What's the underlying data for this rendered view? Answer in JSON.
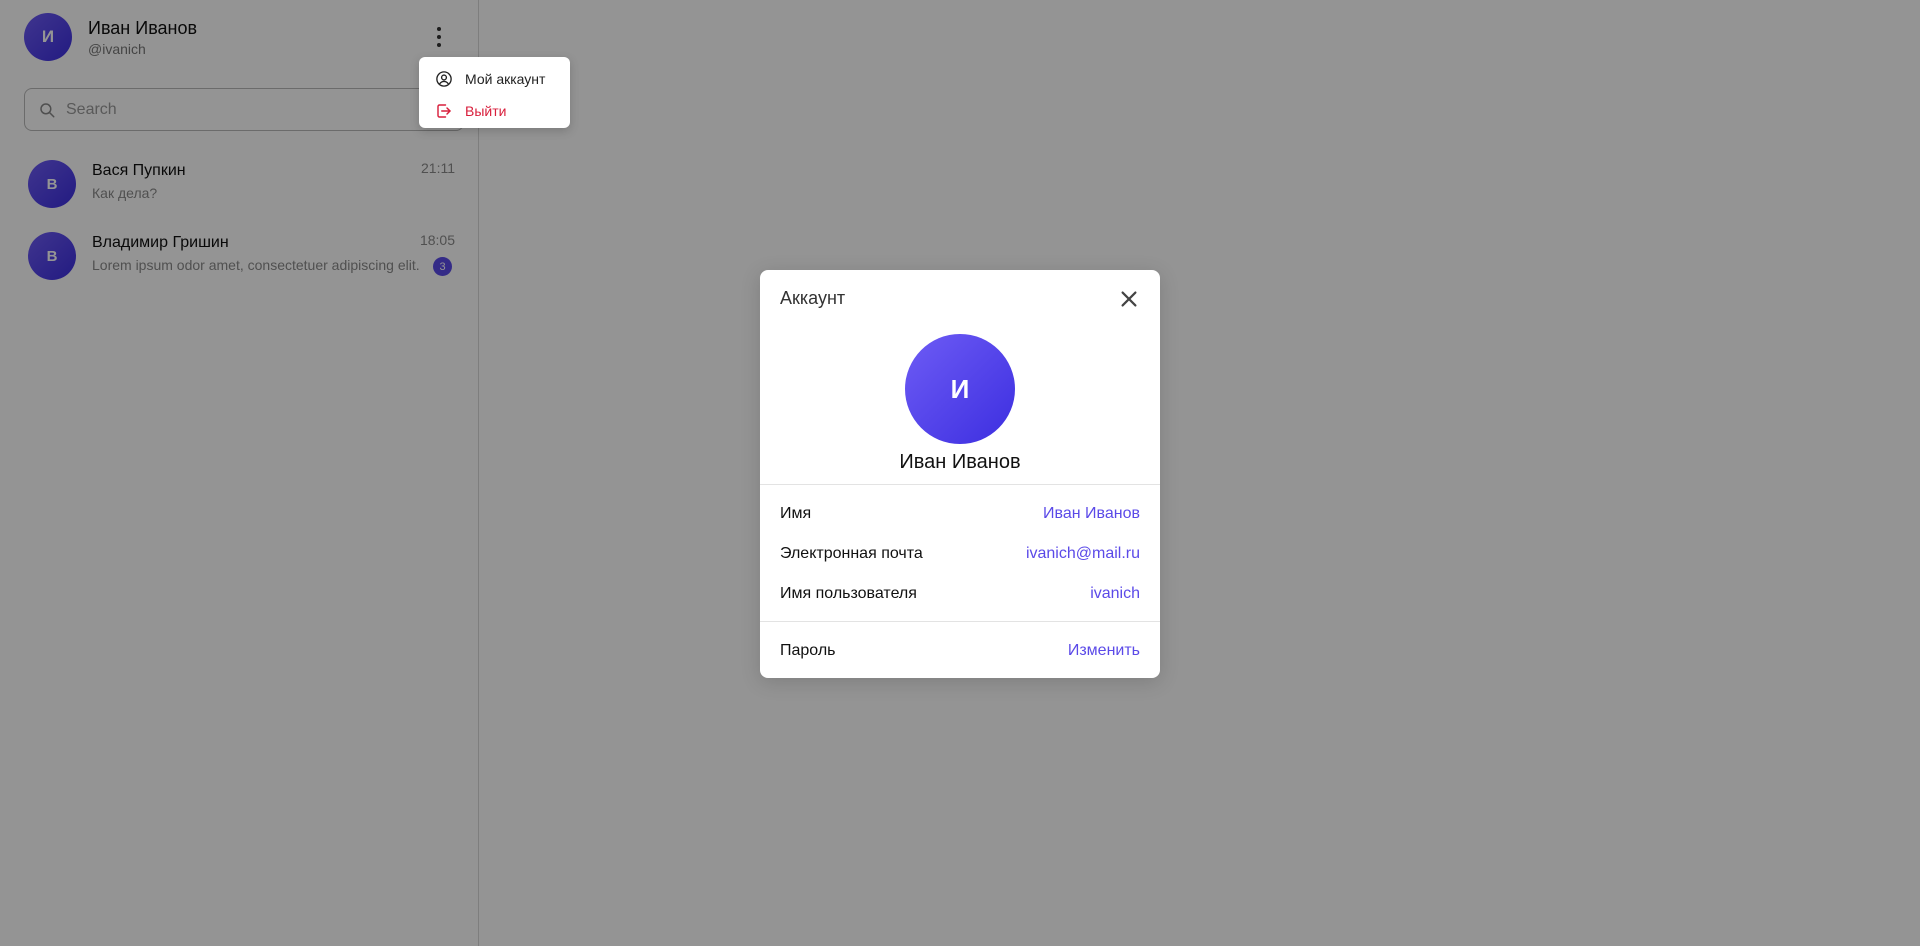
{
  "user": {
    "initial": "И",
    "name": "Иван Иванов",
    "handle": "@ivanich"
  },
  "search": {
    "placeholder": "Search",
    "value": ""
  },
  "chats": [
    {
      "initial": "В",
      "name": "Вася Пупкин",
      "preview": "Как дела?",
      "time": "21:11",
      "unread": null
    },
    {
      "initial": "В",
      "name": "Владимир Гришин",
      "preview": "Lorem ipsum odor amet, consectetuer adipiscing elit.",
      "time": "18:05",
      "unread": "3"
    }
  ],
  "menu": {
    "items": [
      {
        "label": "Мой аккаунт",
        "icon": "user-circle-icon"
      },
      {
        "label": "Выйти",
        "icon": "logout-icon",
        "color": "#d81e3b"
      }
    ]
  },
  "modal": {
    "title": "Аккаунт",
    "avatar_initial": "И",
    "name": "Иван Иванов",
    "rows": [
      {
        "label": "Имя",
        "value": "Иван Иванов"
      },
      {
        "label": "Электронная почта",
        "value": "ivanich@mail.ru"
      },
      {
        "label": "Имя пользователя",
        "value": "ivanich"
      }
    ],
    "password": {
      "label": "Пароль",
      "action": "Изменить"
    }
  },
  "colors": {
    "accent": "#5b4ae8",
    "danger": "#d81e3b",
    "overlay": "rgba(0,0,0,0.42)"
  }
}
